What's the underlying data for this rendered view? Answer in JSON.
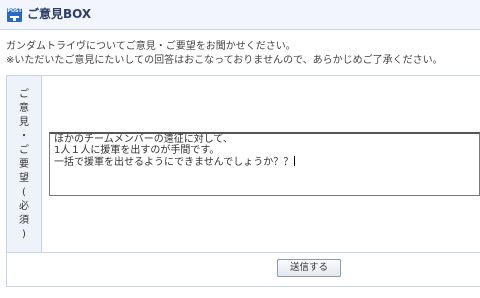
{
  "header": {
    "icon": "post-icon",
    "icon_text": "POST",
    "title": "ご意見BOX"
  },
  "description": {
    "line1": "ガンダムトライヴについてご意見・ご要望をお聞かせください。",
    "line2": "※いただいたご意見にたいしての回答はおこなっておりませんので、あらかじめご了承ください。"
  },
  "form": {
    "label_chars": [
      "ご",
      "意",
      "見",
      "・",
      "ご",
      "要",
      "望",
      "(",
      "必",
      "須",
      ")"
    ],
    "textarea_value": "ほかのチームメンバーの遠征に対して、\n1人１人に援軍を出すのが手間です。\n一括で援軍を出せるようにできませんでしょうか？？"
  },
  "submit": {
    "label": "送信する"
  }
}
